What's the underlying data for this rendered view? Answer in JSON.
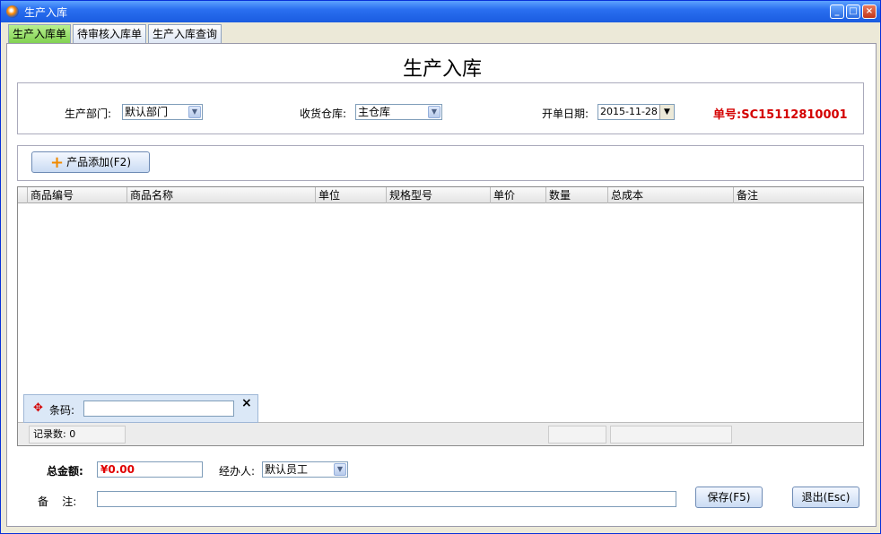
{
  "window": {
    "title": "生产入库"
  },
  "tabs": [
    {
      "label": "生产入库单"
    },
    {
      "label": "待审核入库单"
    },
    {
      "label": "生产入库查询"
    }
  ],
  "page_title": "生产入库",
  "header": {
    "dept_label": "生产部门:",
    "dept_value": "默认部门",
    "warehouse_label": "收货仓库:",
    "warehouse_value": "主仓库",
    "date_label": "开单日期:",
    "date_value": "2015-11-28",
    "order_label": "单号:",
    "order_value": "SC15112810001"
  },
  "toolbar": {
    "add_label": "产品添加(F2)"
  },
  "grid": {
    "columns": [
      "商品编号",
      "商品名称",
      "单位",
      "规格型号",
      "单价",
      "数量",
      "总成本",
      "备注"
    ],
    "rows": [],
    "record_count_text": "记录数: 0"
  },
  "barcode": {
    "label": "条码:",
    "value": ""
  },
  "footer": {
    "total_label": "总金额:",
    "total_value": "¥0.00",
    "handler_label": "经办人:",
    "handler_value": "默认员工",
    "remark_label": "备    注:",
    "remark_value": "",
    "save_label": "保存(F5)",
    "exit_label": "退出(Esc)"
  },
  "colors": {
    "order_no": "#d40000",
    "amount": "#e00000",
    "active_tab": "#7fd04e"
  }
}
